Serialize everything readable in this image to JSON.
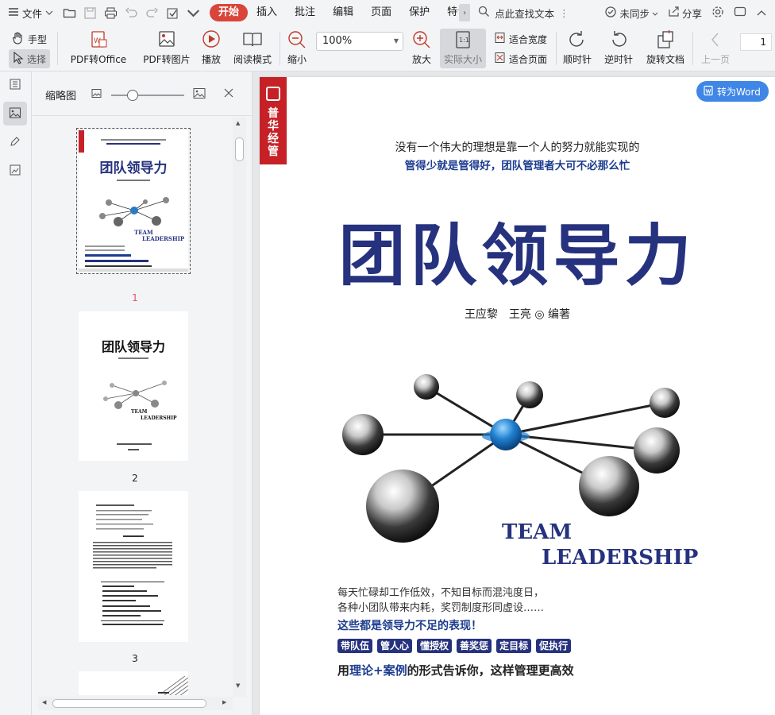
{
  "menubar": {
    "file_label": "文件",
    "tabs": [
      {
        "label": "开始",
        "active": true
      },
      {
        "label": "插入",
        "active": false
      },
      {
        "label": "批注",
        "active": false
      },
      {
        "label": "编辑",
        "active": false
      },
      {
        "label": "页面",
        "active": false
      },
      {
        "label": "保护",
        "active": false
      },
      {
        "label": "特色",
        "active": false
      }
    ],
    "search_label": "点此查找文本",
    "sync_label": "未同步",
    "share_label": "分享",
    "accent_color": "#d9453a"
  },
  "toolbar": {
    "hand_label": "手型",
    "select_label": "选择",
    "pdf_to_office_label": "PDF转Office",
    "pdf_to_image_label": "PDF转图片",
    "play_label": "播放",
    "read_mode_label": "阅读模式",
    "zoom_out_label": "缩小",
    "zoom_value": "100%",
    "zoom_in_label": "放大",
    "actual_size_label": "实际大小",
    "fit_width_label": "适合宽度",
    "fit_page_label": "适合页面",
    "rotate_cw_label": "顺时针",
    "rotate_ccw_label": "逆时针",
    "rotate_doc_label": "旋转文档",
    "prev_page_label": "上一页",
    "page_value": "1"
  },
  "thumbnail_panel": {
    "title": "缩略图",
    "pages": [
      {
        "number": "1",
        "selected": true
      },
      {
        "number": "2",
        "selected": false
      },
      {
        "number": "3",
        "selected": false
      }
    ],
    "thumb2_title": "团队领导力"
  },
  "document": {
    "to_word_label": "转为Word",
    "brand_vertical": "普华经管",
    "tagline1": "没有一个伟大的理想是靠一个人的努力就能实现的",
    "tagline2": "管得少就是管得好，团队管理者大可不必那么忙",
    "title": "团队领导力",
    "authors": "王应黎　王亮 ◎ 编著",
    "team": "TEAM",
    "leadership": "LEADERSHIP",
    "body_line1": "每天忙碌却工作低效，不知目标而混沌度日，",
    "body_line2": "各种小团队带来内耗，奖罚制度形同虚设……",
    "highlight": "这些都是领导力不足的表现！",
    "chips": [
      "带队伍",
      "管人心",
      "懂授权",
      "善奖惩",
      "定目标",
      "促执行"
    ],
    "bottom_pre": "用",
    "bottom_blue1": "理论",
    "bottom_plus": "+",
    "bottom_blue2": "案例",
    "bottom_post": "的形式告诉你，这样管理更高效",
    "title_color": "#26327e",
    "brand_color": "#c52127"
  }
}
